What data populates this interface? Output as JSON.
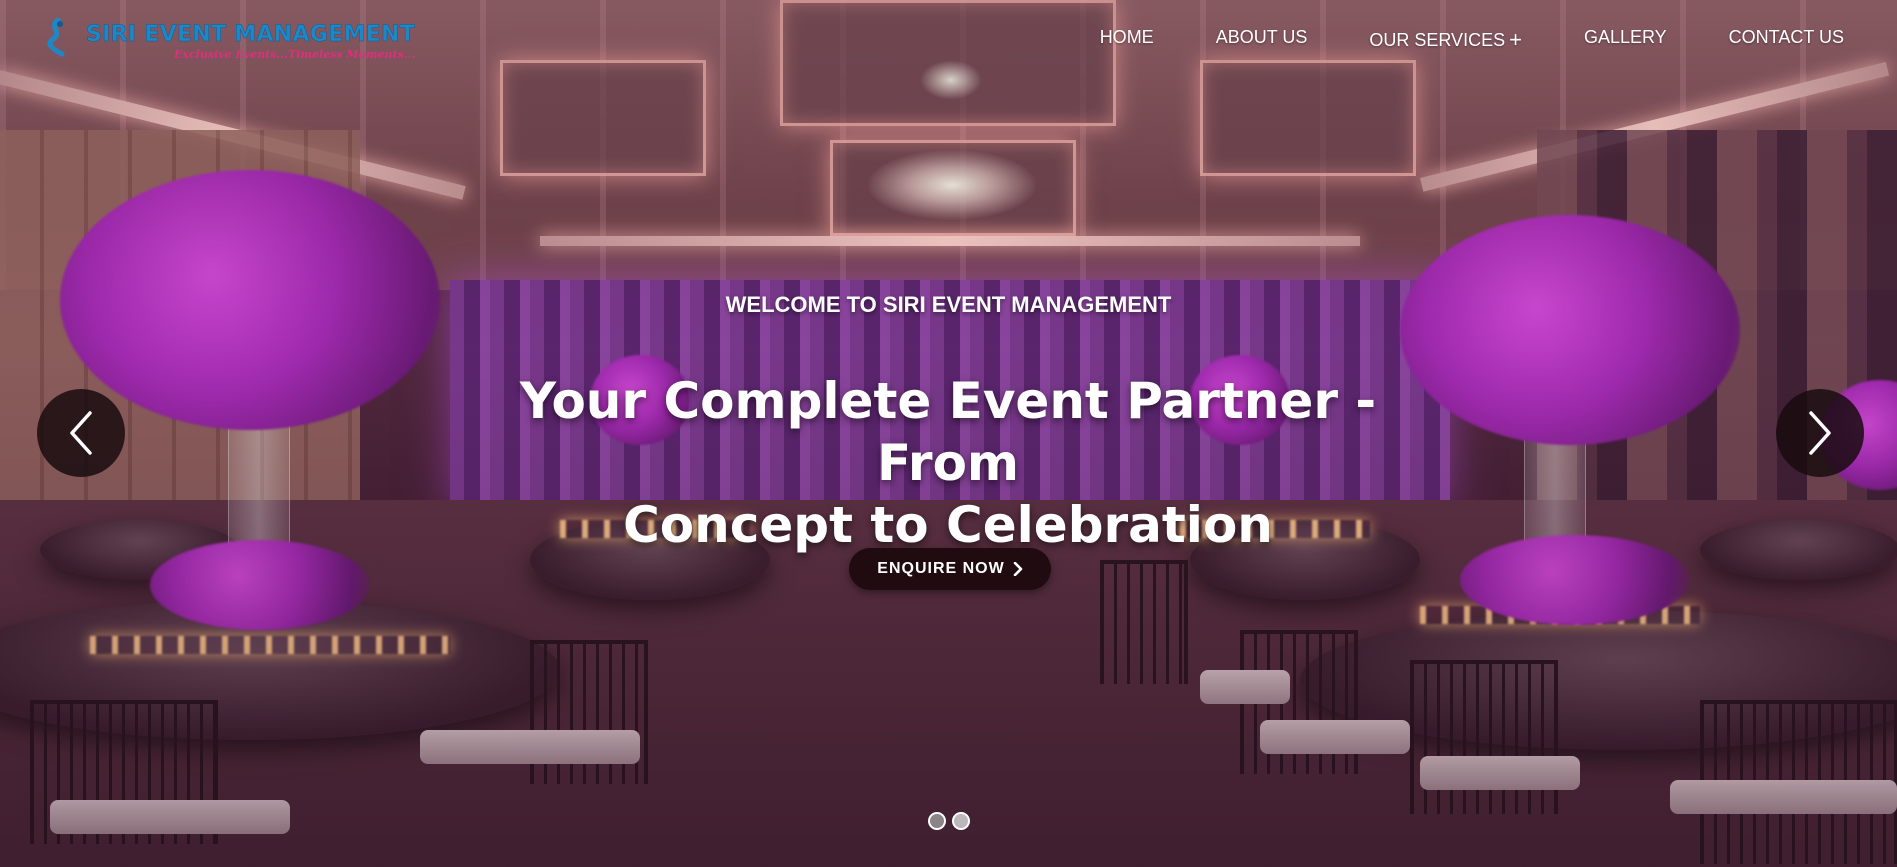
{
  "brand": {
    "name": "SIRI EVENT MANAGEMENT",
    "tagline": "Exclusive Events...Timeless Moments..."
  },
  "nav": {
    "items": [
      {
        "label": "HOME"
      },
      {
        "label": "ABOUT US"
      },
      {
        "label": "OUR SERVICES"
      },
      {
        "label": "GALLERY"
      },
      {
        "label": "CONTACT US"
      }
    ],
    "services_toggle": "+"
  },
  "hero": {
    "welcome": "WELCOME TO SIRI EVENT MANAGEMENT",
    "headline_line1": "Your Complete Event Partner - From",
    "headline_line2": "Concept to Celebration",
    "cta_label": "ENQUIRE NOW"
  },
  "carousel": {
    "slide_count": 2,
    "active_slide": 1,
    "prev_icon": "chevron-left-icon",
    "next_icon": "chevron-right-icon"
  },
  "colors": {
    "brand_blue": "#1e88c7",
    "brand_pink": "#d8327a",
    "cta_background": "#1f0b10",
    "arrow_background": "#190c0f"
  }
}
